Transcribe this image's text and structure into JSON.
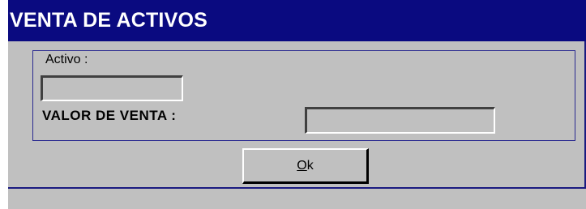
{
  "window": {
    "title": "VENTA DE ACTIVOS",
    "title_bar_color": "#0a0a80",
    "background_color": "#c0c0c0"
  },
  "form": {
    "activo_label": "Activo :",
    "activo_value": "",
    "valor_label": "VALOR DE VENTA :",
    "valor_value": ""
  },
  "buttons": {
    "ok_mnemonic": "O",
    "ok_rest": "k"
  }
}
